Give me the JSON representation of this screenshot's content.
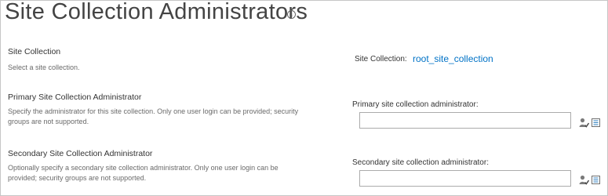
{
  "page": {
    "title": "Site Collection Administrators",
    "info_icon": "info-circle-icon"
  },
  "site_collection": {
    "section_title": "Site Collection",
    "section_description": "Select a site collection.",
    "label": "Site Collection:",
    "value": "root_site_collection"
  },
  "primary_admin": {
    "section_title": "Primary Site Collection Administrator",
    "section_description": "Specify the administrator for this site collection. Only one user login can be provided; security groups are not supported.",
    "field_label": "Primary site collection administrator:",
    "value": "",
    "check_names_icon": "check-names-icon",
    "browse_icon": "address-book-icon"
  },
  "secondary_admin": {
    "section_title": "Secondary Site Collection Administrator",
    "section_description": "Optionally specify a secondary site collection administrator. Only one user login can be provided; security groups are not supported.",
    "field_label": "Secondary site collection administrator:",
    "value": "",
    "check_names_icon": "check-names-icon",
    "browse_icon": "address-book-icon"
  },
  "colors": {
    "link": "#0072c6",
    "border": "#ababab"
  }
}
